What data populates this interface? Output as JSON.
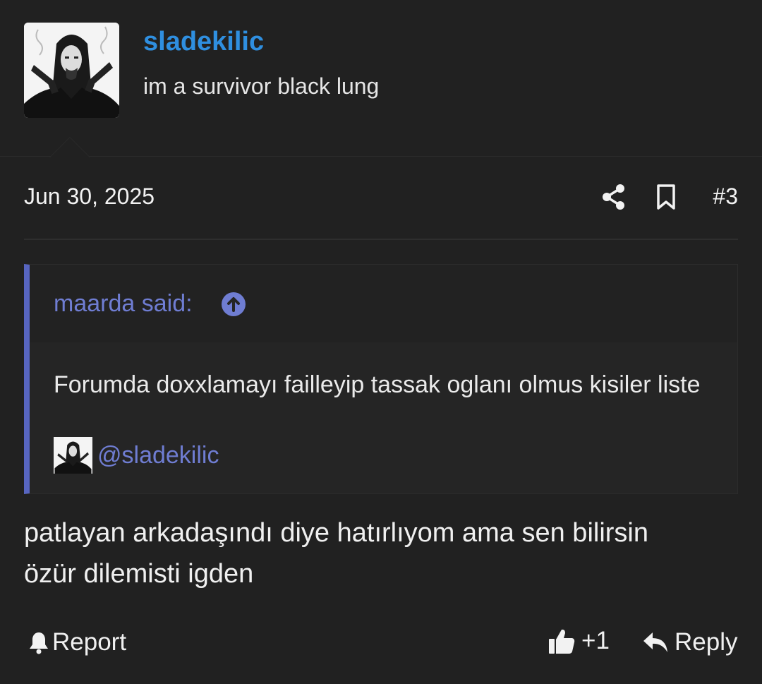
{
  "author": {
    "username": "sladekilic",
    "user_title": "im a survivor black lung",
    "avatar_icon": "avatar-gunslinger-image"
  },
  "post": {
    "date": "Jun 30, 2025",
    "number": "#3",
    "body_lines": [
      "patlayan arkadaşındı diye hatırlıyom ama sen bilirsin",
      "özür dilemisti igden"
    ]
  },
  "quote": {
    "author_label": "maarda said:",
    "body": "Forumda doxxlamayı failleyip tassak oglanı olmus kisiler liste",
    "mention": "@sladekilic"
  },
  "actions": {
    "report_label": "Report",
    "like_label": "+1",
    "reply_label": "Reply"
  },
  "colors": {
    "background": "#212121",
    "username": "#2f8fe0",
    "quote_accent": "#5765c0",
    "quote_link": "#6f7dd2",
    "text": "#f0f0f0"
  },
  "icons": [
    "share-icon",
    "bookmark-icon",
    "arrow-up-circle-icon",
    "bell-icon",
    "thumbs-up-icon",
    "reply-icon"
  ]
}
